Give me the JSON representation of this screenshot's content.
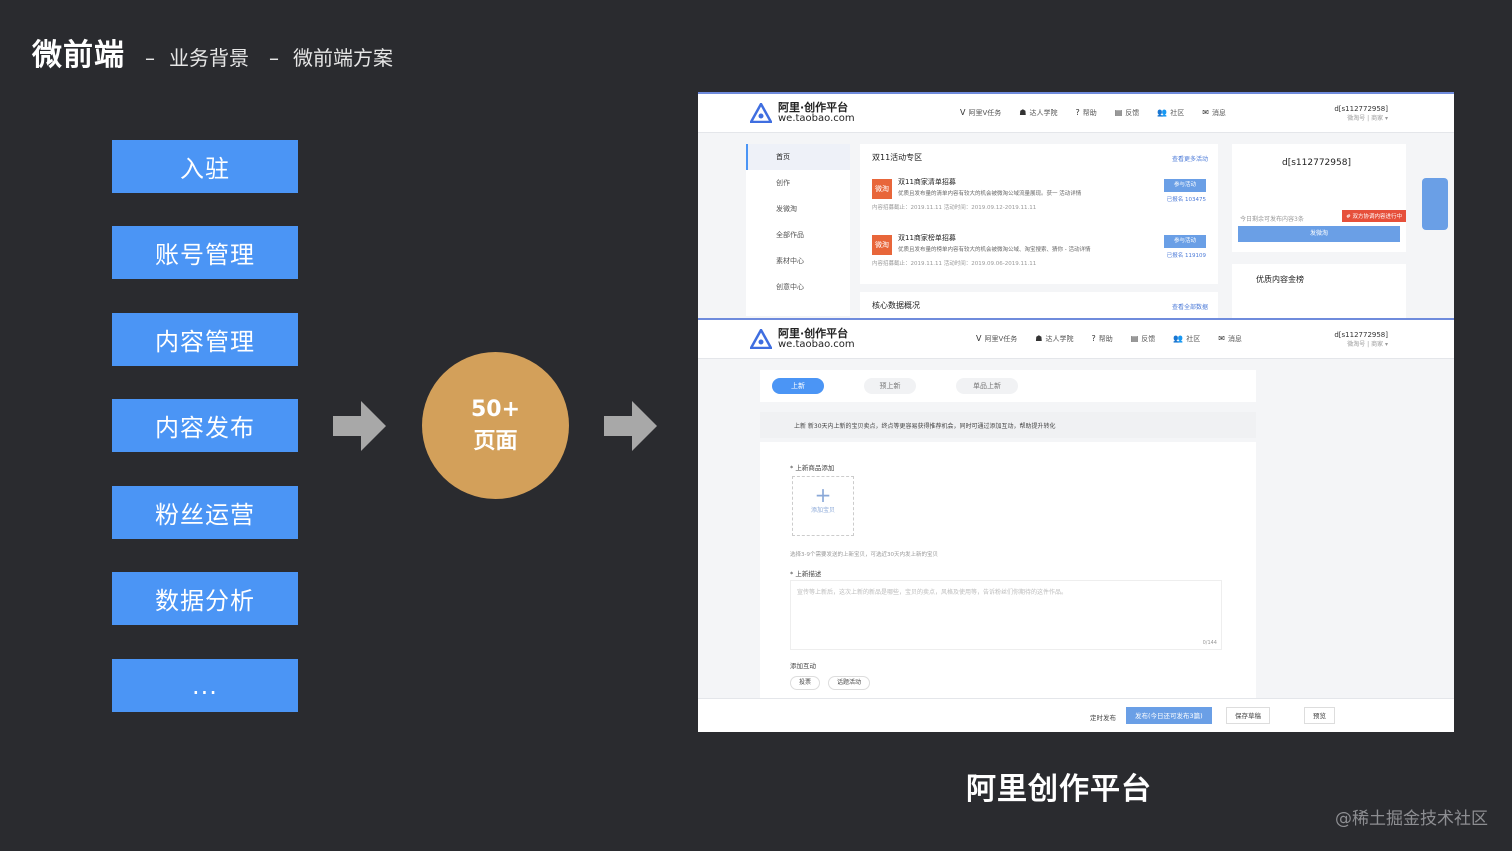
{
  "title": {
    "main": "微前端",
    "sep1": "–",
    "part1": "业务背景",
    "sep2": "–",
    "part2": "微前端方案"
  },
  "menu": [
    "入驻",
    "账号管理",
    "内容管理",
    "内容发布",
    "粉丝运营",
    "数据分析",
    "..."
  ],
  "circle": {
    "line1": "50+",
    "line2": "页面"
  },
  "shot": {
    "logo_name": "阿里·创作平台",
    "logo_url": "we.taobao.com",
    "nav": [
      {
        "icon": "V",
        "label": "阿里V任务"
      },
      {
        "icon": "☗",
        "label": "达人学院"
      },
      {
        "icon": "?",
        "label": "帮助"
      },
      {
        "icon": "▤",
        "label": "反馈"
      },
      {
        "icon": "👥",
        "label": "社区"
      },
      {
        "icon": "✉",
        "label": "消息"
      }
    ],
    "user_name": "d[s112772958]",
    "user_sub": "微淘号 | 商家 ▾",
    "sidebar": [
      "首页",
      "创作",
      "发微淘",
      "全部作品",
      "素材中心",
      "创意中心"
    ],
    "activity_title": "双11活动专区",
    "activity_more": "查看更多活动",
    "activities": [
      {
        "badge": "微淘",
        "title": "双11商家清单招募",
        "desc": "优质且发布量的清单内容有较大的机会被微淘公域流量展现。获一 活动详情",
        "meta": "内容招募截止：2019.11.11      活动时间：2019.09.12-2019.11.11",
        "button": "参与活动",
        "count": "已报名 103475"
      },
      {
        "badge": "微淘",
        "title": "双11商家榜单招募",
        "desc": "优质且发布量的榜单内容有较大的机会被微淘公域、淘宝搜索、猜你 - 活动详情",
        "meta": "内容招募截止：2019.11.11      活动时间：2019.09.06-2019.11.11",
        "button": "参与活动",
        "count": "已报名 119109"
      }
    ],
    "data_title": "核心数据概况",
    "data_more": "查看全部数据",
    "publish_tip": "今日剩余可发布内容3条",
    "publish_tag": "# 双方协调内容进行中",
    "publish_button": "发微淘",
    "rank_title": "优质内容金榜",
    "tabs": [
      "上新",
      "预上新",
      "单品上新"
    ],
    "note": "上新  新30天内上新的宝贝卖点，终点等更容易获得推荐机会，同时可通过添加互动，帮助提升转化",
    "form_label1": "* 上新商品添加",
    "add_label": "添加宝贝",
    "hint": "选择3-9个需要发送的上新宝贝，可选近30天内发上新的宝贝",
    "form_label2": "* 上新描述",
    "area_placeholder": "宣传等上新后，这次上新的新品是哪些，宝贝的卖点，风格及使用等，告诉粉丝们你期待的这件作品。",
    "area_count": "0/144",
    "form_label3": "添加互动",
    "chips": [
      "投票",
      "话题活动"
    ],
    "footer": {
      "schedule": "定时发布",
      "publish": "发布(今日还可发布3篇)",
      "draft": "保存草稿",
      "preview": "预览"
    }
  },
  "caption": "阿里创作平台",
  "watermark": "@稀土掘金技术社区"
}
